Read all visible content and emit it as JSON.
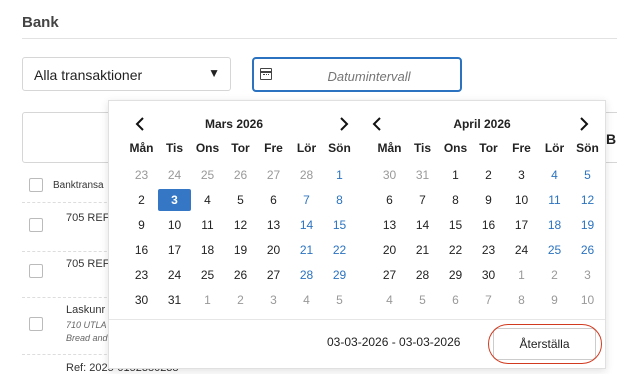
{
  "page": {
    "title": "Bank"
  },
  "filter": {
    "selected": "Alla transaktioner",
    "arrow": "▼"
  },
  "date_input": {
    "placeholder": "Datumintervall"
  },
  "table": {
    "header_partial": "Banktransa",
    "right_header_partial": "Br",
    "rows": [
      {
        "text": "705 REF",
        "sub1": "",
        "sub2": ""
      },
      {
        "text": "705 REF",
        "sub1": "",
        "sub2": ""
      },
      {
        "text": "Laskunr",
        "sub1": "710 UTLA",
        "sub2": "Bread and"
      },
      {
        "text": "Ref: 2025-0152380238",
        "sub1": "",
        "sub2": ""
      }
    ]
  },
  "calendar": {
    "weekdays": [
      "Mån",
      "Tis",
      "Ons",
      "Tor",
      "Fre",
      "Lör",
      "Sön"
    ],
    "months": [
      {
        "title": "Mars 2026",
        "weeks": [
          [
            {
              "d": "23",
              "t": "other"
            },
            {
              "d": "24",
              "t": "other"
            },
            {
              "d": "25",
              "t": "other"
            },
            {
              "d": "26",
              "t": "other"
            },
            {
              "d": "27",
              "t": "other"
            },
            {
              "d": "28",
              "t": "other"
            },
            {
              "d": "1",
              "t": "wknd"
            }
          ],
          [
            {
              "d": "2",
              "t": ""
            },
            {
              "d": "3",
              "t": "sel"
            },
            {
              "d": "4",
              "t": ""
            },
            {
              "d": "5",
              "t": ""
            },
            {
              "d": "6",
              "t": ""
            },
            {
              "d": "7",
              "t": "wknd"
            },
            {
              "d": "8",
              "t": "wknd"
            }
          ],
          [
            {
              "d": "9",
              "t": ""
            },
            {
              "d": "10",
              "t": ""
            },
            {
              "d": "11",
              "t": ""
            },
            {
              "d": "12",
              "t": ""
            },
            {
              "d": "13",
              "t": ""
            },
            {
              "d": "14",
              "t": "wknd"
            },
            {
              "d": "15",
              "t": "wknd"
            }
          ],
          [
            {
              "d": "16",
              "t": ""
            },
            {
              "d": "17",
              "t": ""
            },
            {
              "d": "18",
              "t": ""
            },
            {
              "d": "19",
              "t": ""
            },
            {
              "d": "20",
              "t": ""
            },
            {
              "d": "21",
              "t": "wknd"
            },
            {
              "d": "22",
              "t": "wknd"
            }
          ],
          [
            {
              "d": "23",
              "t": ""
            },
            {
              "d": "24",
              "t": ""
            },
            {
              "d": "25",
              "t": ""
            },
            {
              "d": "26",
              "t": ""
            },
            {
              "d": "27",
              "t": ""
            },
            {
              "d": "28",
              "t": "wknd"
            },
            {
              "d": "29",
              "t": "wknd"
            }
          ],
          [
            {
              "d": "30",
              "t": ""
            },
            {
              "d": "31",
              "t": ""
            },
            {
              "d": "1",
              "t": "other"
            },
            {
              "d": "2",
              "t": "other"
            },
            {
              "d": "3",
              "t": "other"
            },
            {
              "d": "4",
              "t": "other"
            },
            {
              "d": "5",
              "t": "other"
            }
          ]
        ]
      },
      {
        "title": "April 2026",
        "weeks": [
          [
            {
              "d": "30",
              "t": "other"
            },
            {
              "d": "31",
              "t": "other"
            },
            {
              "d": "1",
              "t": ""
            },
            {
              "d": "2",
              "t": ""
            },
            {
              "d": "3",
              "t": ""
            },
            {
              "d": "4",
              "t": "wknd"
            },
            {
              "d": "5",
              "t": "wknd"
            }
          ],
          [
            {
              "d": "6",
              "t": ""
            },
            {
              "d": "7",
              "t": ""
            },
            {
              "d": "8",
              "t": ""
            },
            {
              "d": "9",
              "t": ""
            },
            {
              "d": "10",
              "t": ""
            },
            {
              "d": "11",
              "t": "wknd"
            },
            {
              "d": "12",
              "t": "wknd"
            }
          ],
          [
            {
              "d": "13",
              "t": ""
            },
            {
              "d": "14",
              "t": ""
            },
            {
              "d": "15",
              "t": ""
            },
            {
              "d": "16",
              "t": ""
            },
            {
              "d": "17",
              "t": ""
            },
            {
              "d": "18",
              "t": "wknd"
            },
            {
              "d": "19",
              "t": "wknd"
            }
          ],
          [
            {
              "d": "20",
              "t": ""
            },
            {
              "d": "21",
              "t": ""
            },
            {
              "d": "22",
              "t": ""
            },
            {
              "d": "23",
              "t": ""
            },
            {
              "d": "24",
              "t": ""
            },
            {
              "d": "25",
              "t": "wknd"
            },
            {
              "d": "26",
              "t": "wknd"
            }
          ],
          [
            {
              "d": "27",
              "t": ""
            },
            {
              "d": "28",
              "t": ""
            },
            {
              "d": "29",
              "t": ""
            },
            {
              "d": "30",
              "t": ""
            },
            {
              "d": "1",
              "t": "other"
            },
            {
              "d": "2",
              "t": "other"
            },
            {
              "d": "3",
              "t": "other"
            }
          ],
          [
            {
              "d": "4",
              "t": "other"
            },
            {
              "d": "5",
              "t": "other"
            },
            {
              "d": "6",
              "t": "other"
            },
            {
              "d": "7",
              "t": "other"
            },
            {
              "d": "8",
              "t": "other"
            },
            {
              "d": "9",
              "t": "other"
            },
            {
              "d": "10",
              "t": "other"
            }
          ]
        ]
      }
    ],
    "range_text": "03-03-2026 - 03-03-2026",
    "reset_label": "Återställa"
  },
  "colors": {
    "accent": "#3577c4",
    "weekend": "#2b73c0",
    "highlight_ring": "#d23a1f"
  },
  "icons": {
    "prev": "chevron-left-icon",
    "next": "chevron-right-icon",
    "calendar": "calendar-icon"
  }
}
